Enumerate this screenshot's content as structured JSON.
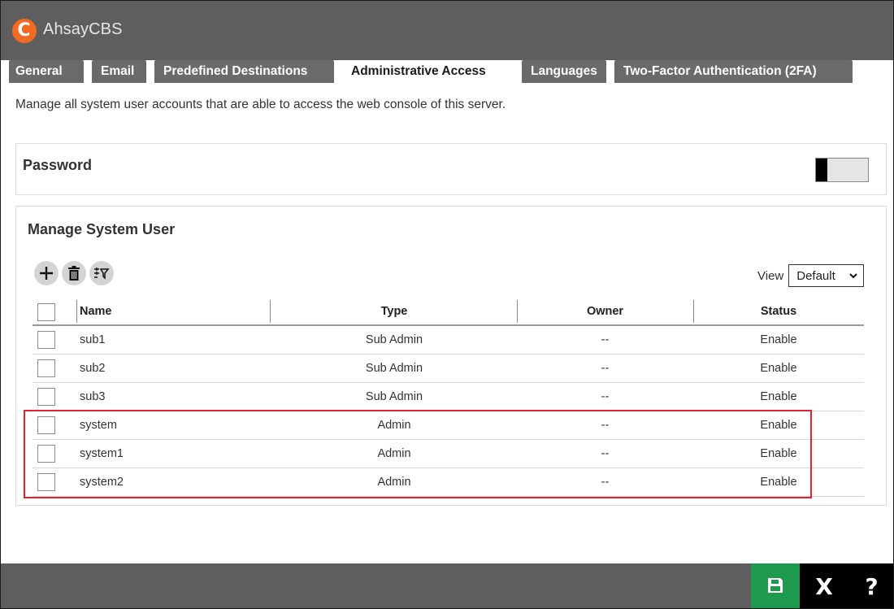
{
  "app": {
    "title": "AhsayCBS",
    "logo_letter": "C"
  },
  "tabs": [
    {
      "label": "General",
      "active": false
    },
    {
      "label": "Email",
      "active": false
    },
    {
      "label": "Predefined Destinations",
      "active": false
    },
    {
      "label": "Administrative Access",
      "active": true
    },
    {
      "label": "Languages",
      "active": false
    },
    {
      "label": "Two-Factor Authentication (2FA)",
      "active": false
    }
  ],
  "description": "Manage all system user accounts that are able to access the web console of this server.",
  "password_panel": {
    "title": "Password",
    "toggle_on": false
  },
  "users_panel": {
    "title": "Manage System User",
    "toolbar_icons": [
      "add-icon",
      "delete-icon",
      "filter-icon"
    ],
    "view_label": "View",
    "view_selected": "Default"
  },
  "table": {
    "headers": {
      "name": "Name",
      "type": "Type",
      "owner": "Owner",
      "status": "Status"
    },
    "rows": [
      {
        "name": "sub1",
        "type": "Sub Admin",
        "owner": "--",
        "status": "Enable"
      },
      {
        "name": "sub2",
        "type": "Sub Admin",
        "owner": "--",
        "status": "Enable"
      },
      {
        "name": "sub3",
        "type": "Sub Admin",
        "owner": "--",
        "status": "Enable"
      },
      {
        "name": "system",
        "type": "Admin",
        "owner": "--",
        "status": "Enable"
      },
      {
        "name": "system1",
        "type": "Admin",
        "owner": "--",
        "status": "Enable"
      },
      {
        "name": "system2",
        "type": "Admin",
        "owner": "--",
        "status": "Enable"
      }
    ]
  },
  "footer": {
    "save_icon": "save-icon",
    "close_label": "X",
    "help_label": "?"
  },
  "colors": {
    "accent_orange": "#f26a21",
    "titlebar": "#5e5e5e",
    "save_green": "#1d9a4e",
    "highlight_red": "#e0202c"
  }
}
